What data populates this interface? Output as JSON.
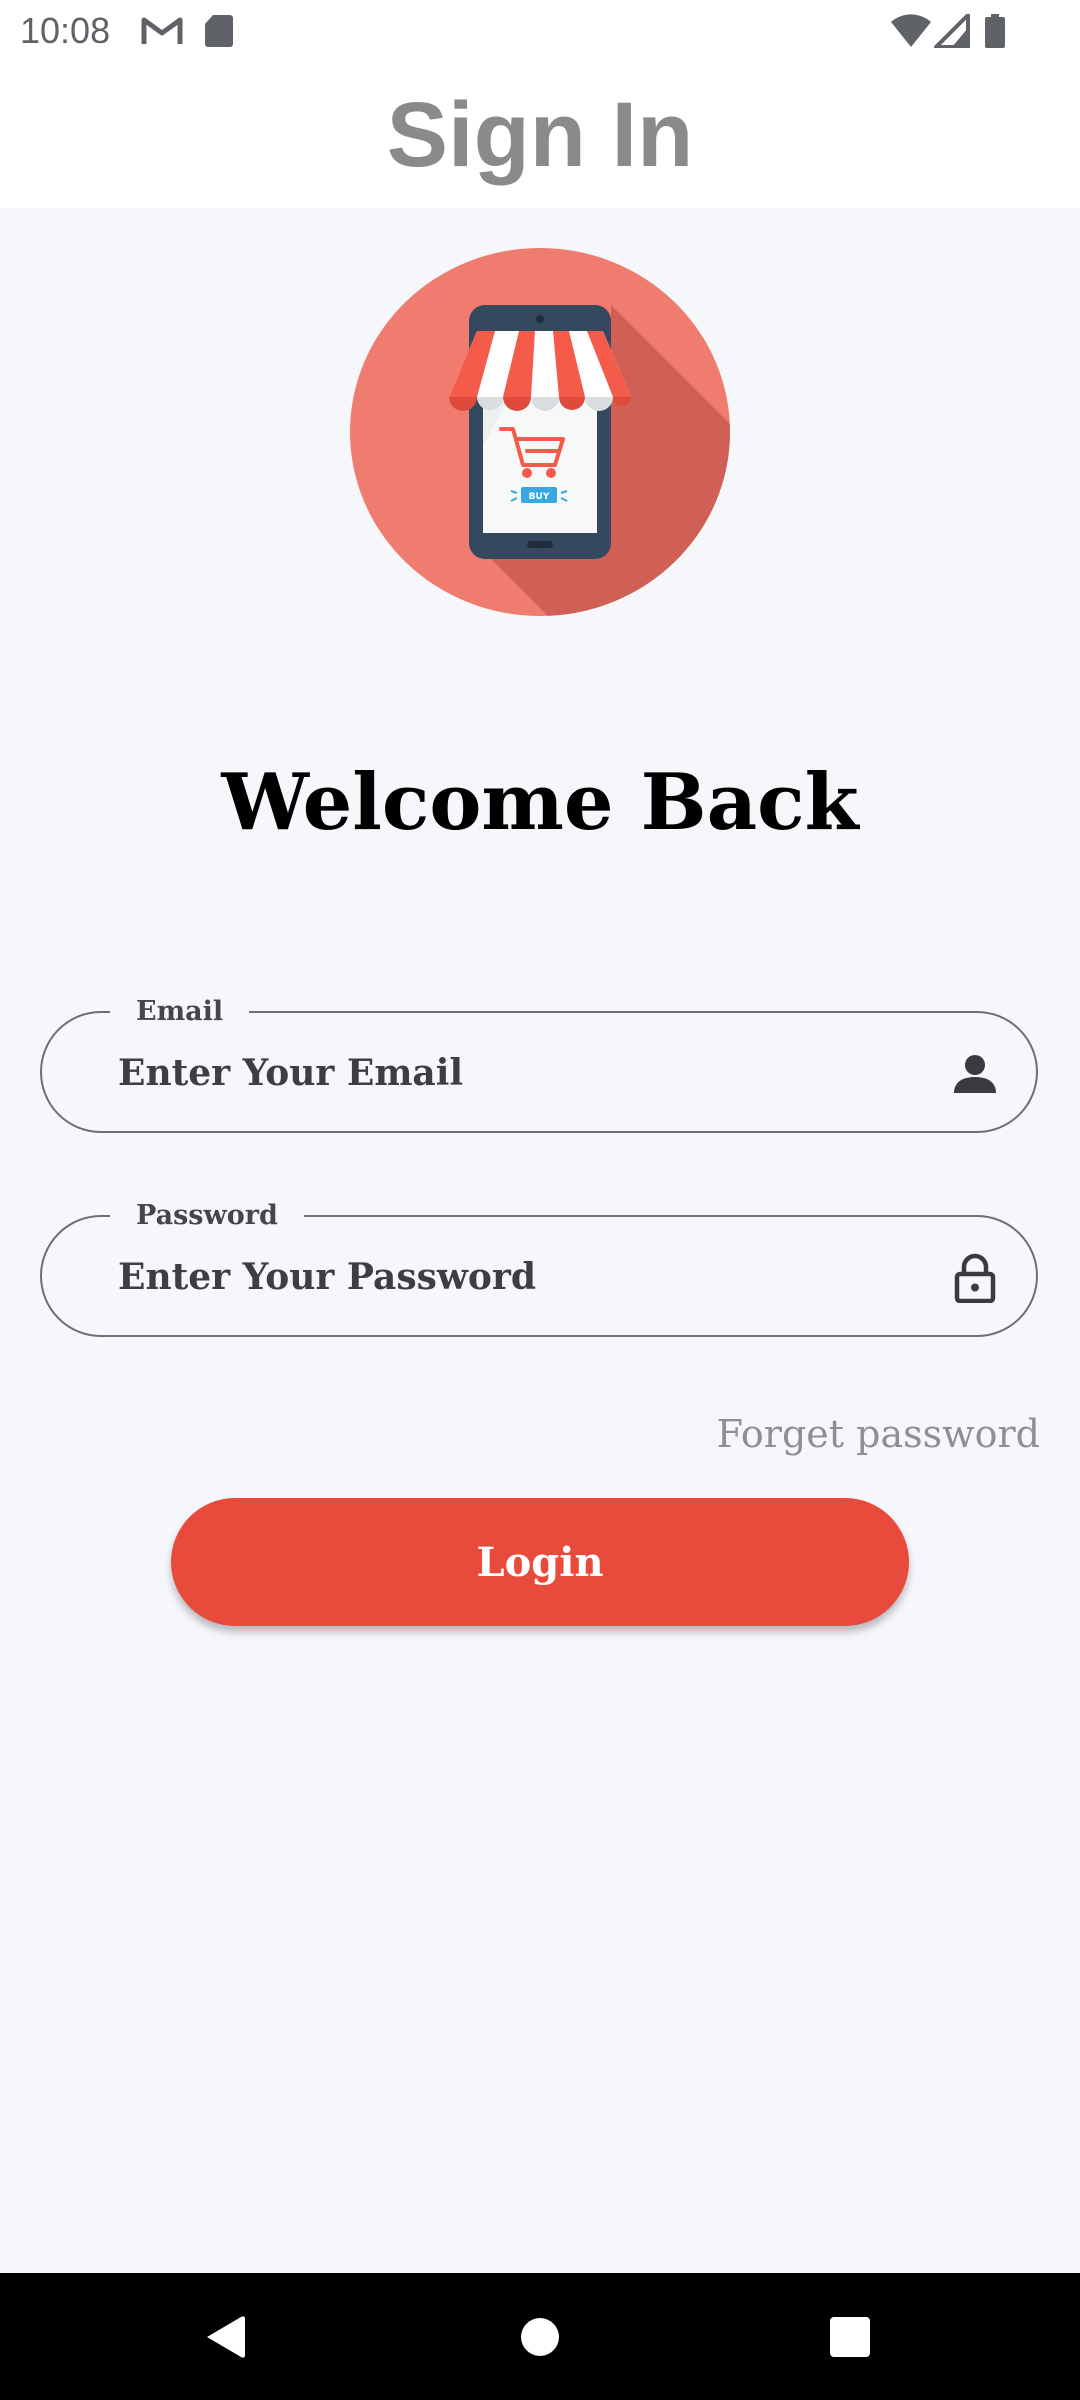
{
  "status_bar": {
    "time": "10:08",
    "left_icons": [
      "gmail-icon",
      "sd-card-icon"
    ],
    "right_icons": [
      "wifi-icon",
      "signal-icon",
      "battery-icon"
    ]
  },
  "app_bar": {
    "title": "Sign In"
  },
  "logo": {
    "icon": "shop-phone-cart-icon",
    "buy_badge": "BUY",
    "colors": {
      "circle": "#f07b6f",
      "shadow": "#d05f55",
      "phone": "#34495e",
      "awning_red": "#f45b4b",
      "cart": "#f45b4b",
      "badge": "#3aa8e0"
    }
  },
  "welcome": {
    "heading": "Welcome Back"
  },
  "form": {
    "email": {
      "label": "Email",
      "placeholder": "Enter Your Email",
      "value": "",
      "icon": "person-icon"
    },
    "password": {
      "label": "Password",
      "placeholder": "Enter Your Password",
      "value": "",
      "icon": "lock-icon"
    },
    "forgot_label": "Forget password",
    "login_label": "Login"
  },
  "nav_bar": {
    "buttons": [
      "back-icon",
      "home-icon",
      "recents-icon"
    ]
  },
  "colors": {
    "accent": "#e84b3c",
    "background": "#f6f7fb",
    "app_bar": "#ffffff",
    "title_text": "#8a8a8a"
  }
}
